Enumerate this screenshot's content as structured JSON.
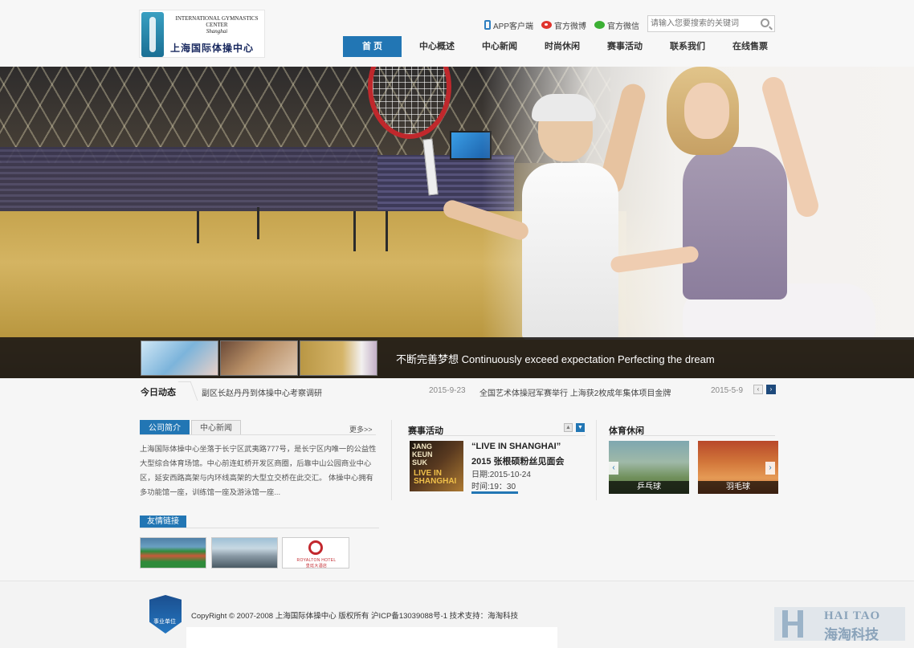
{
  "header": {
    "logo": {
      "en_line1": "International Gymnastics",
      "en_line2": "Center",
      "en_line3": "Shanghai",
      "cn": "上海国际体操中心"
    },
    "toplinks": [
      {
        "label": "APP客户端",
        "icon": "phone-icon"
      },
      {
        "label": "官方微博",
        "icon": "weibo-icon"
      },
      {
        "label": "官方微信",
        "icon": "wechat-icon"
      }
    ],
    "search": {
      "placeholder": "请输入您要搜索的关键词"
    },
    "nav": [
      {
        "label": "首 页",
        "active": true
      },
      {
        "label": "中心概述"
      },
      {
        "label": "中心新闻"
      },
      {
        "label": "时尚休闲"
      },
      {
        "label": "赛事活动"
      },
      {
        "label": "联系我们"
      },
      {
        "label": "在线售票"
      }
    ]
  },
  "banner": {
    "slogan": "不断完善梦想 Continuously exceed expectation Perfecting the dream"
  },
  "ticker": {
    "title": "今日动态",
    "items": [
      {
        "text": "副区长赵丹丹到体操中心考察调研",
        "date": "2015-9-23"
      },
      {
        "text": "全国艺术体操冠军赛举行 上海获2枚成年集体项目金牌",
        "date": "2015-5-9"
      }
    ]
  },
  "about": {
    "tabs": [
      "公司简介",
      "中心新闻"
    ],
    "more": "更多>>",
    "text": "上海国际体操中心坐落于长宁区武夷路777号，是长宁区内唯一的公益性大型综合体育场馆。中心前连虹桥开发区商圈，后靠中山公园商业中心区，延安西路高架与内环线高架的大型立交桥在此交汇。 体操中心拥有多功能馆一座，训练馆一座及游泳馆一座..."
  },
  "events": {
    "title": "赛事活动",
    "image_text": "JANG KEUN SUK",
    "image_text2": "LIVE IN SHANGHAI",
    "headline1": "“LIVE IN SHANGHAI”",
    "headline2": "2015 张根硕粉丝见面会",
    "date": "日期:2015-10-24",
    "time": "时间:19：30"
  },
  "sports": {
    "title": "体育休闲",
    "items": [
      "乒乓球",
      "羽毛球"
    ]
  },
  "links": {
    "title": "友情链接",
    "hotel_name": "ROYALTON HOTEL",
    "hotel_cn": "皇廷大酒店"
  },
  "footer": {
    "badge": "事业单位",
    "copyright": "CopyRight © 2007-2008 上海国际体操中心 版权所有 沪ICP备13039088号-1 技术支持：海淘科技",
    "watermark_en": "HAI TAO",
    "watermark_cn": "海淘科技"
  },
  "colors": {
    "accent": "#2276b4",
    "banner_bar": "#1a1816"
  }
}
